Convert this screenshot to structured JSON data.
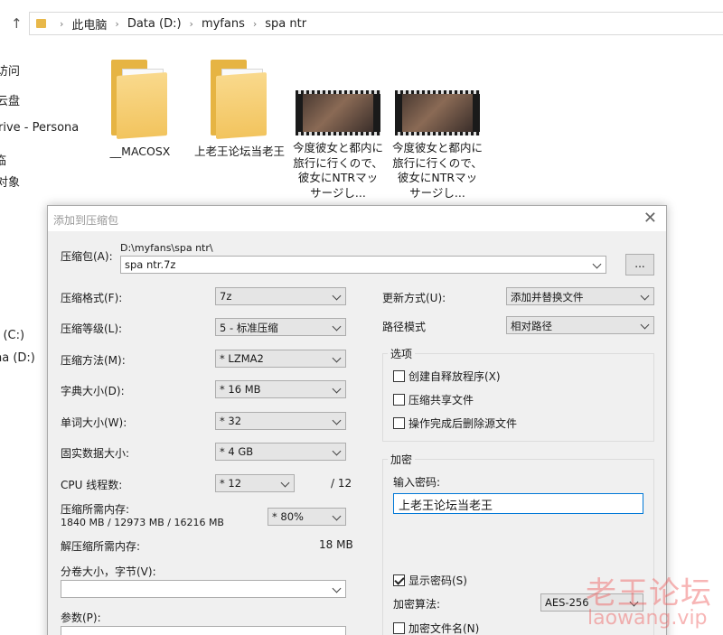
{
  "explorer": {
    "breadcrumb": [
      "此电脑",
      "Data (D:)",
      "myfans",
      "spa ntr"
    ],
    "nav_items": [
      "访问",
      "云盘",
      "rive - Persona",
      "临",
      "对象",
      "r (C:)",
      "na (D:)"
    ],
    "files": [
      {
        "name": "__MACOSX",
        "type": "folder"
      },
      {
        "name": "上老王论坛当老王",
        "type": "folder"
      },
      {
        "name": "今度彼女と都内に旅行に行くので、彼女にNTRマッサージし...",
        "type": "video"
      },
      {
        "name": "今度彼女と都内に旅行に行くので、彼女にNTRマッサージし...",
        "type": "video"
      }
    ]
  },
  "dialog": {
    "title": "添加到压缩包",
    "archive_label": "压缩包(A):",
    "archive_path": "D:\\myfans\\spa ntr\\",
    "archive_name": "spa ntr.7z",
    "browse_label": "...",
    "format_label": "压缩格式(F):",
    "format_value": "7z",
    "level_label": "压缩等级(L):",
    "level_value": "5 - 标准压缩",
    "method_label": "压缩方法(M):",
    "method_value": "* LZMA2",
    "dict_label": "字典大小(D):",
    "dict_value": "* 16 MB",
    "word_label": "单词大小(W):",
    "word_value": "* 32",
    "solid_label": "固实数据大小:",
    "solid_value": "* 4 GB",
    "cpu_label": "CPU 线程数:",
    "cpu_value": "* 12",
    "cpu_total": "/ 12",
    "mem_label": "压缩所需内存:",
    "mem_detail": "1840 MB / 12973 MB / 16216 MB",
    "mem_percent": "* 80%",
    "decomp_label": "解压缩所需内存:",
    "decomp_value": "18 MB",
    "split_label": "分卷大小，字节(V):",
    "split_value": "",
    "params_label": "参数(P):",
    "update_label": "更新方式(U):",
    "update_value": "添加并替换文件",
    "path_label": "路径模式",
    "path_value": "相对路径",
    "options_title": "选项",
    "opt_sfx": "创建自释放程序(X)",
    "opt_shared": "压缩共享文件",
    "opt_delete": "操作完成后删除源文件",
    "encrypt_title": "加密",
    "password_label": "输入密码:",
    "password_value": "上老王论坛当老王",
    "show_password": "显示密码(S)",
    "enc_method_label": "加密算法:",
    "enc_method_value": "AES-256",
    "encrypt_names": "加密文件名(N)"
  },
  "watermark": {
    "text": "老王论坛",
    "url": "laowang.vip"
  },
  "colors": {
    "accent": "#0078d7",
    "folder": "#f2c45e",
    "watermark": "#ee5a5a"
  }
}
